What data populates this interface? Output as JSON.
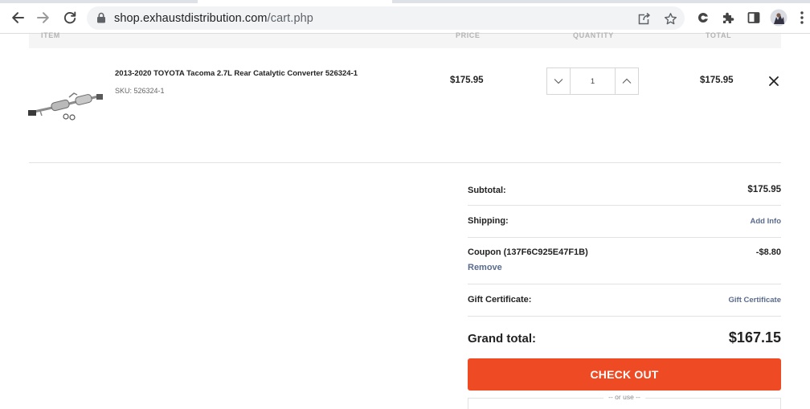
{
  "browser": {
    "url_host": "shop.exhaustdistribution.com",
    "url_path": "/cart.php",
    "icons": [
      "back-icon",
      "forward-icon",
      "reload-icon",
      "lock-icon",
      "share-icon",
      "star-icon",
      "extension-icon",
      "puzzle-icon",
      "sidepanel-icon",
      "avatar",
      "kebab-menu-icon"
    ]
  },
  "table_header": {
    "item": "ITEM",
    "price": "PRICE",
    "quantity": "QUANTITY",
    "total": "TOTAL"
  },
  "cart_item": {
    "name": "2013-2020 TOYOTA Tacoma 2.7L Rear Catalytic Converter 526324-1",
    "sku": "SKU: 526324-1",
    "price": "$175.95",
    "quantity": "1",
    "total": "$175.95"
  },
  "totals": {
    "subtotal_label": "Subtotal:",
    "subtotal_value": "$175.95",
    "shipping_label": "Shipping:",
    "shipping_link": "Add Info",
    "coupon_label": "Coupon (137F6C925E47F1B)",
    "coupon_value": "-$8.80",
    "coupon_remove": "Remove",
    "gift_label": "Gift Certificate:",
    "gift_link": "Gift Certificate",
    "grand_label": "Grand total:",
    "grand_value": "$167.15"
  },
  "checkout": {
    "button_label": "CHECK OUT",
    "or_use": "-- or use --"
  },
  "colors": {
    "accent": "#ee4a23",
    "link": "#5a6b8c"
  }
}
